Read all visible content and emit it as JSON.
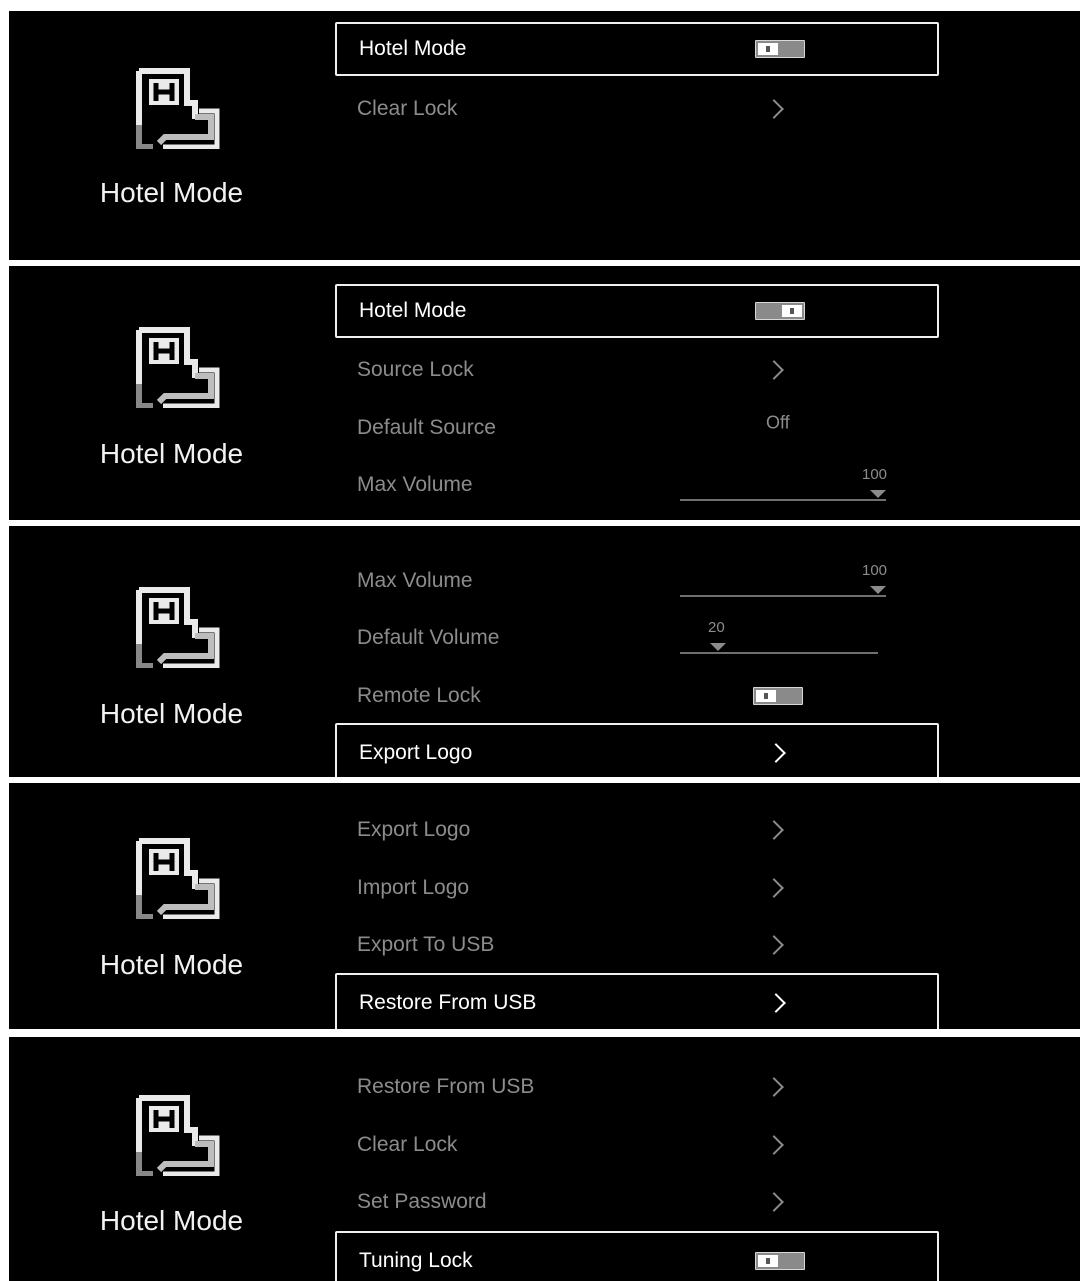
{
  "brand": {
    "title": "Hotel Mode",
    "icon": "hotel-mode-icon"
  },
  "panels": [
    {
      "rows": [
        {
          "label": "Hotel Mode",
          "type": "toggle",
          "state": "off",
          "focused": true
        },
        {
          "label": "Clear Lock",
          "type": "arrow"
        }
      ]
    },
    {
      "rows": [
        {
          "label": "Hotel Mode",
          "type": "toggle",
          "state": "on",
          "focused": true
        },
        {
          "label": "Source Lock",
          "type": "arrow"
        },
        {
          "label": "Default Source",
          "type": "value",
          "value": "Off"
        },
        {
          "label": "Max Volume",
          "type": "slider",
          "value": "100",
          "fraction": 1.0
        }
      ]
    },
    {
      "rows": [
        {
          "label": "Max Volume",
          "type": "slider",
          "value": "100",
          "fraction": 1.0
        },
        {
          "label": "Default Volume",
          "type": "slider",
          "value": "20",
          "fraction": 0.2
        },
        {
          "label": "Remote Lock",
          "type": "toggle",
          "state": "off"
        },
        {
          "label": "Export Logo",
          "type": "arrow",
          "focused": true
        }
      ]
    },
    {
      "rows": [
        {
          "label": "Export Logo",
          "type": "arrow"
        },
        {
          "label": "Import Logo",
          "type": "arrow"
        },
        {
          "label": "Export To USB",
          "type": "arrow"
        },
        {
          "label": "Restore From USB",
          "type": "arrow",
          "focused": true
        }
      ]
    },
    {
      "rows": [
        {
          "label": "Restore From USB",
          "type": "arrow"
        },
        {
          "label": "Clear Lock",
          "type": "arrow"
        },
        {
          "label": "Set Password",
          "type": "arrow"
        },
        {
          "label": "Tuning Lock",
          "type": "toggle",
          "state": "off",
          "focused": true
        }
      ]
    }
  ]
}
